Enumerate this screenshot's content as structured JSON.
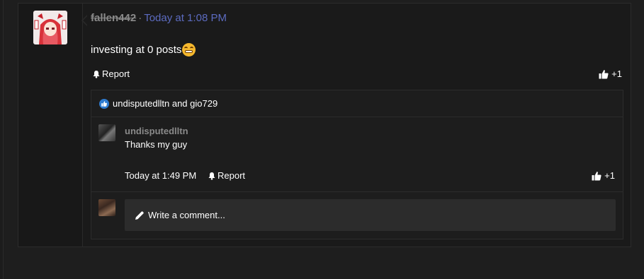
{
  "post": {
    "username": "fallen442",
    "separator": "·",
    "timestamp": "Today at 1:08 PM",
    "message": "investing at 0 posts",
    "emoji": "grimacing-face",
    "report_label": "Report",
    "like_count": "+1"
  },
  "comments": {
    "liked_by": "undisputedlltn and gio729",
    "items": [
      {
        "username": "undisputedlltn",
        "text": "Thanks my guy",
        "timestamp": "Today at 1:49 PM",
        "report_label": "Report",
        "like_count": "+1"
      }
    ],
    "write_placeholder": "Write a comment..."
  },
  "colors": {
    "accent_link": "#5c6bc0",
    "like_badge": "#2e7bcf"
  }
}
